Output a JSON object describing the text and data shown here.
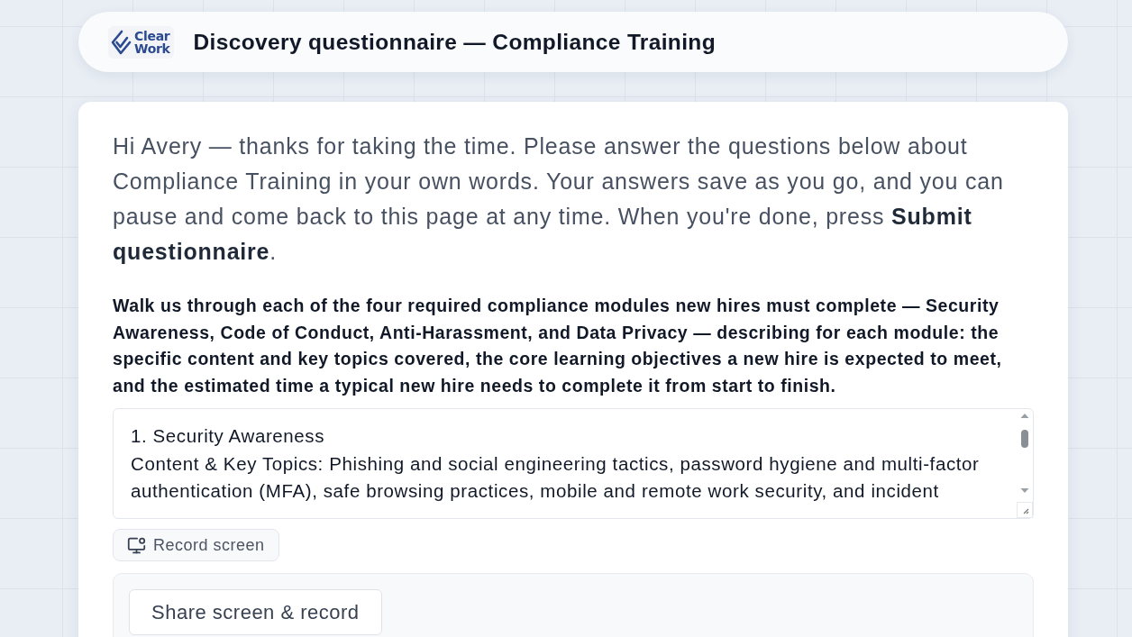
{
  "header": {
    "logo": [
      "Clear",
      "Work"
    ],
    "title": "Discovery questionnaire — Compliance Training"
  },
  "intro": "Hi Avery — thanks for taking the time. Please answer the questions below about Compliance Training in your own words. Your answers save as you go, and you can pause and come back to this page at any time. When you're done, press **Submit questionnaire**.",
  "question": {
    "prompt": "Walk us through each of the four required compliance modules new hires must complete — Security Awareness, Code of Conduct, Anti-Harassment, and Data Privacy — describing for each module: the specific content and key topics covered, the core learning objectives a new hire is expected to meet, and the estimated time a typical new hire needs to complete it from start to finish.",
    "answer": "1. Security Awareness\nContent & Key Topics: Phishing and social engineering tactics, password hygiene and multi-factor authentication (MFA), safe browsing practices, mobile and remote work security, and incident"
  },
  "record_button": {
    "label": "Record screen"
  },
  "recorder_panel": {
    "button": "Share screen & record"
  }
}
